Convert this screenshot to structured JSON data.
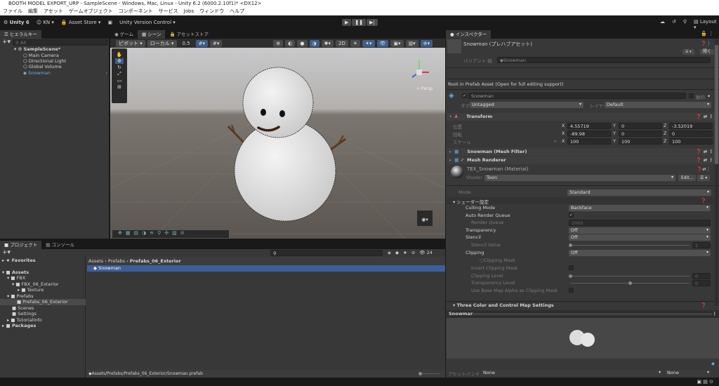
{
  "window": {
    "title": "BOOTH MODEL EXPORT_URP - SampleScene - Windows, Mac, Linux - Unity 6.2 (6000.2.10f1)* <DX12>"
  },
  "menu": [
    "ファイル",
    "編集",
    "アセット",
    "ゲームオブジェクト",
    "コンポーネント",
    "サービス",
    "Jobs",
    "ウィンドウ",
    "ヘルプ"
  ],
  "toolbar": {
    "unity": "Unity 6",
    "account": "KN",
    "asset_store": "Asset Store",
    "version_control": "Unity Version Control",
    "layout": "Layout"
  },
  "hierarchy": {
    "tab": "ヒエラルキー",
    "search_placeholder": "All",
    "scene": "SampleScene*",
    "items": [
      "Main Camera",
      "Directional Light",
      "Global Volume",
      "Snowman"
    ]
  },
  "scene_tabs": [
    "ゲーム",
    "シーン",
    "アセットストア"
  ],
  "scene_toolbar": {
    "pivot": "ピボット",
    "local": "ローカル",
    "snap": "0.5",
    "persp": "< Persp"
  },
  "project": {
    "tabs": [
      "プロジェクト",
      "コンソール"
    ],
    "favorites": "Favorites",
    "tree": [
      "Assets",
      "FBX",
      "FBX_06_Exterior",
      "Texture",
      "Prefabs",
      "Prefabs_06_Exterior",
      "Scenes",
      "Settings",
      "TutorialInfo",
      "Packages"
    ],
    "breadcrumb": [
      "Assets",
      "Prefabs",
      "Prefabs_06_Exterior"
    ],
    "selected_item": "Snowman",
    "path": "Assets/Prefabs/Prefabs_06_Exterior/Snowman.prefab",
    "count": "24"
  },
  "inspector": {
    "tab": "インスペクター",
    "title": "Snowman (プレハブアセット)",
    "open": "開く",
    "variant_label": "バリアント 親",
    "variant_value": "Snowman",
    "root_note": "Root in Prefab Asset (Open for full editing support)",
    "name": "Snowman",
    "static": "静的",
    "tag_label": "タグ",
    "tag": "Untagged",
    "layer_label": "レイヤー",
    "layer": "Default",
    "transform": {
      "title": "Transform",
      "position_label": "位置",
      "rotation_label": "回転",
      "scale_label": "スケール",
      "position": [
        "4.55719",
        "0",
        "-3.52019"
      ],
      "rotation": [
        "-89.98",
        "0",
        "0"
      ],
      "scale": [
        "100",
        "100",
        "100"
      ],
      "axes": [
        "X",
        "Y",
        "Z"
      ]
    },
    "mesh_filter": "Snowman (Mesh Filter)",
    "mesh_renderer": "Mesh Renderer",
    "material": {
      "name": "TEX_Snowman (Material)",
      "shader_label": "Shader",
      "shader": "Toon",
      "edit": "Edit..."
    },
    "props": {
      "mode_label": "Mode",
      "mode": "Standard",
      "shader_settings": "シェーダー設定",
      "culling_label": "Culling Mode",
      "culling": "Backface",
      "auto_rq": "Auto Render Queue",
      "rq_label": "Render Queue",
      "rq": "2000",
      "transparency_label": "Transparency",
      "transparency": "Off",
      "stencil_label": "Stencil",
      "stencil": "Off",
      "stencil_value_label": "Stencil Value",
      "stencil_value": "1",
      "clipping_label": "Clipping",
      "clipping": "Off",
      "clipping_mask": "○Clipping Mask",
      "invert_mask": "Invert Clipping Mask",
      "clip_level_label": "Clipping Level",
      "clip_level": "0",
      "trans_level_label": "Transparency Level",
      "trans_level": "0",
      "use_base": "Use Base Map Alpha as Clipping Mask",
      "three_color": "Three Color and Control Map Settings"
    },
    "preview_title": "Snowman",
    "asset_bundle_label": "アセットバンドル",
    "asset_bundle": "None",
    "asset_variant": "None"
  }
}
